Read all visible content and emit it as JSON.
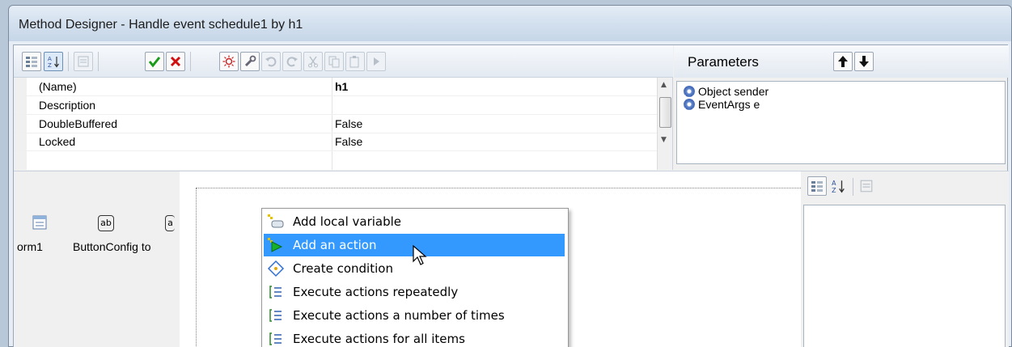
{
  "window": {
    "title": "Method Designer - Handle event schedule1 by h1"
  },
  "toolbar": {
    "buttons": [
      {
        "name": "categorized",
        "icon": "categorized-icon",
        "enabled": true
      },
      {
        "name": "alphabetical",
        "icon": "sort-az-icon",
        "enabled": true
      },
      {
        "name": "property-pages",
        "icon": "property-pages-icon",
        "enabled": false
      },
      {
        "name": "ok",
        "icon": "check-icon",
        "enabled": true
      },
      {
        "name": "cancel",
        "icon": "red-x-icon",
        "enabled": true
      },
      {
        "name": "settings",
        "icon": "sun-gear-icon",
        "enabled": true
      },
      {
        "name": "wrench",
        "icon": "wrench-icon",
        "enabled": true
      },
      {
        "name": "undo",
        "icon": "undo-icon",
        "enabled": false
      },
      {
        "name": "redo",
        "icon": "redo-icon",
        "enabled": false
      },
      {
        "name": "cut",
        "icon": "cut-icon",
        "enabled": false
      },
      {
        "name": "copy",
        "icon": "copy-icon",
        "enabled": false
      },
      {
        "name": "paste",
        "icon": "paste-icon",
        "enabled": false
      },
      {
        "name": "run",
        "icon": "play-icon",
        "enabled": false
      }
    ]
  },
  "properties": {
    "rows": [
      {
        "name": "(Name)",
        "value": "h1",
        "bold": true
      },
      {
        "name": "Description",
        "value": ""
      },
      {
        "name": "DoubleBuffered",
        "value": "False"
      },
      {
        "name": "Locked",
        "value": "False"
      }
    ]
  },
  "parameters": {
    "title": "Parameters",
    "items": [
      {
        "label": "Object sender",
        "icon": "gear-icon"
      },
      {
        "label": "EventArgs e",
        "icon": "gear-icon"
      }
    ]
  },
  "toolbox": {
    "items": [
      {
        "label": "orm1",
        "icon": "form-icon"
      },
      {
        "label": "ButtonConfig to",
        "icon": "textbox-ab-icon"
      }
    ]
  },
  "context_menu": {
    "items": [
      {
        "label": "Add local variable",
        "icon": "local-variable-icon",
        "highlighted": false
      },
      {
        "label": "Add an action",
        "icon": "action-arrow-icon",
        "highlighted": true
      },
      {
        "label": "Create condition",
        "icon": "condition-diamond-icon",
        "highlighted": false
      },
      {
        "label": "Execute actions repeatedly",
        "icon": "loop-list-icon",
        "highlighted": false
      },
      {
        "label": "Execute actions a number of times",
        "icon": "loop-list-icon",
        "highlighted": false
      },
      {
        "label": "Execute actions for all items",
        "icon": "loop-list-icon",
        "highlighted": false
      }
    ]
  },
  "colors": {
    "highlight": "#3399ff",
    "ok_green": "#1a9a1a",
    "cancel_red": "#d01010"
  }
}
